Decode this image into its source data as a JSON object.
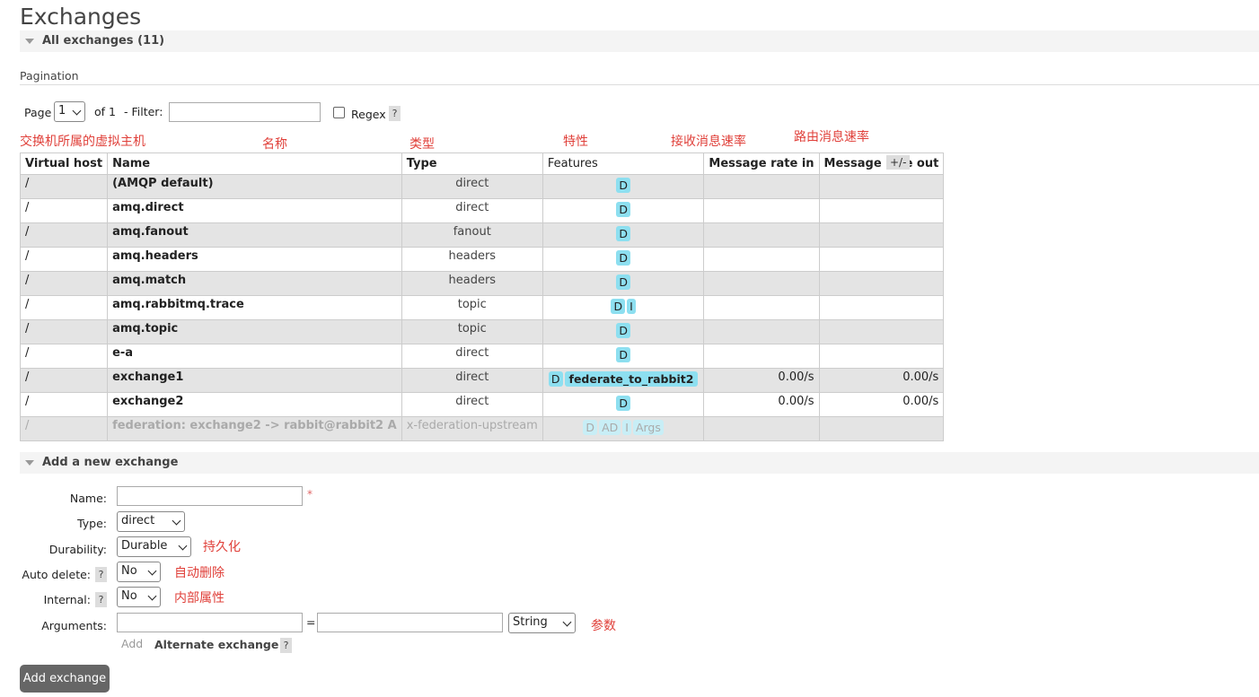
{
  "page": {
    "title": "Exchanges"
  },
  "sections": {
    "all_exchanges": "All exchanges (11)",
    "add_new": "Add a new exchange"
  },
  "pagination": {
    "label": "Pagination",
    "page_label": "Page",
    "page_value": "1",
    "of_label": "of 1",
    "filter_label": "- Filter:",
    "regex_label": "Regex",
    "help": "?"
  },
  "annotations": {
    "vhost": "交换机所属的虚拟主机",
    "name": "名称",
    "type": "类型",
    "features": "特性",
    "rate_in": "接收消息速率",
    "rate_out": "路由消息速率",
    "durability": "持久化",
    "auto_delete": "自动删除",
    "internal": "内部属性",
    "arguments": "参数"
  },
  "table": {
    "headers": [
      "Virtual host",
      "Name",
      "Type",
      "Features",
      "Message rate in",
      "Message rate out"
    ],
    "toggle": "+/-",
    "rows": [
      {
        "vhost": "/",
        "name": "(AMQP default)",
        "type": "direct",
        "features": [
          "D"
        ],
        "rate_in": "",
        "rate_out": ""
      },
      {
        "vhost": "/",
        "name": "amq.direct",
        "type": "direct",
        "features": [
          "D"
        ],
        "rate_in": "",
        "rate_out": ""
      },
      {
        "vhost": "/",
        "name": "amq.fanout",
        "type": "fanout",
        "features": [
          "D"
        ],
        "rate_in": "",
        "rate_out": ""
      },
      {
        "vhost": "/",
        "name": "amq.headers",
        "type": "headers",
        "features": [
          "D"
        ],
        "rate_in": "",
        "rate_out": ""
      },
      {
        "vhost": "/",
        "name": "amq.match",
        "type": "headers",
        "features": [
          "D"
        ],
        "rate_in": "",
        "rate_out": ""
      },
      {
        "vhost": "/",
        "name": "amq.rabbitmq.trace",
        "type": "topic",
        "features": [
          "D",
          "I"
        ],
        "rate_in": "",
        "rate_out": ""
      },
      {
        "vhost": "/",
        "name": "amq.topic",
        "type": "topic",
        "features": [
          "D"
        ],
        "rate_in": "",
        "rate_out": ""
      },
      {
        "vhost": "/",
        "name": "e-a",
        "type": "direct",
        "features": [
          "D"
        ],
        "rate_in": "",
        "rate_out": ""
      },
      {
        "vhost": "/",
        "name": "exchange1",
        "type": "direct",
        "features": [
          "D",
          "federate_to_rabbit2"
        ],
        "rate_in": "0.00/s",
        "rate_out": "0.00/s"
      },
      {
        "vhost": "/",
        "name": "exchange2",
        "type": "direct",
        "features": [
          "D"
        ],
        "rate_in": "0.00/s",
        "rate_out": "0.00/s"
      },
      {
        "vhost": "/",
        "name": "federation: exchange2 -> rabbit@rabbit2 A",
        "type": "x-federation-upstream",
        "features": [
          "D",
          "AD",
          "I",
          "Args"
        ],
        "rate_in": "",
        "rate_out": ""
      }
    ]
  },
  "form": {
    "name_label": "Name:",
    "name_value": "",
    "required_mark": "*",
    "type_label": "Type:",
    "type_value": "direct",
    "durability_label": "Durability:",
    "durability_value": "Durable",
    "auto_delete_label": "Auto delete:",
    "auto_delete_value": "No",
    "internal_label": "Internal:",
    "internal_value": "No",
    "arguments_label": "Arguments:",
    "arg_key": "",
    "arg_eq": "=",
    "arg_value": "",
    "arg_type": "String",
    "add_link": "Add",
    "alternate_exchange": "Alternate exchange",
    "submit": "Add exchange"
  }
}
